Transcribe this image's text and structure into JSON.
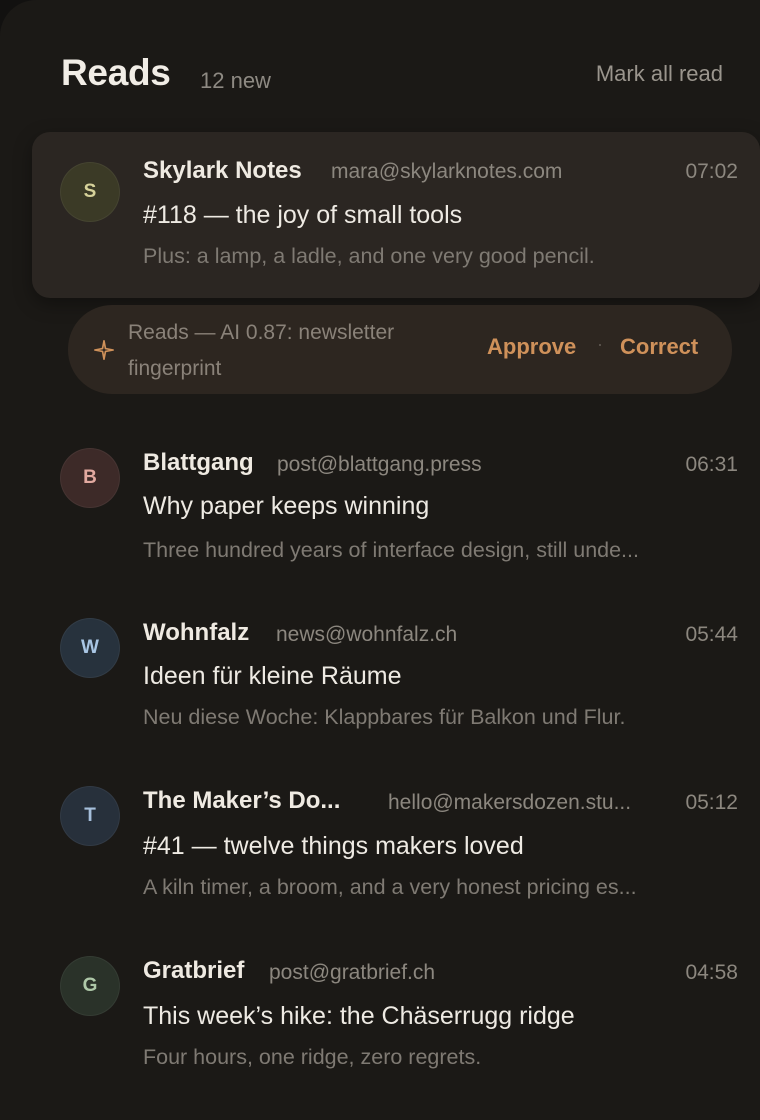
{
  "header": {
    "title": "Reads",
    "new_count": "12 new",
    "mark_all_label": "Mark all read"
  },
  "messages": [
    {
      "initial": "S",
      "sender": "Skylark Notes",
      "email": "mara@skylarknotes.com",
      "time": "07:02",
      "subject": "#118 — the joy of small tools",
      "preview": "Plus: a lamp, a ladle, and one very good pencil.",
      "avatar_bg": "#3b3a26",
      "avatar_fg": "#d6d29a"
    },
    {
      "initial": "B",
      "sender": "Blattgang",
      "email": "post@blattgang.press",
      "time": "06:31",
      "subject": "Why paper keeps winning",
      "preview": "Three hundred years of interface design, still unde...",
      "avatar_bg": "#3d2a28",
      "avatar_fg": "#e2a9a0"
    },
    {
      "initial": "W",
      "sender": "Wohnfalz",
      "email": "news@wohnfalz.ch",
      "time": "05:44",
      "subject": "Ideen für kleine Räume",
      "preview": "Neu diese Woche: Klappbares für Balkon und Flur.",
      "avatar_bg": "#27323d",
      "avatar_fg": "#a9c6e4"
    },
    {
      "initial": "T",
      "sender": "The Maker’s Do...",
      "email": "hello@makersdozen.stu...",
      "time": "05:12",
      "subject": "#41 — twelve things makers loved",
      "preview": "A kiln timer, a broom, and a very honest pricing es...",
      "avatar_bg": "#27303b",
      "avatar_fg": "#a6bfdb"
    },
    {
      "initial": "G",
      "sender": "Gratbrief",
      "email": "post@gratbrief.ch",
      "time": "04:58",
      "subject": "This week’s hike: the Chäserrugg ridge",
      "preview": "Four hours, one ridge, zero regrets.",
      "avatar_bg": "#2a3229",
      "avatar_fg": "#aec8a8"
    }
  ],
  "ai_suggestion": {
    "icon": "sparkle-icon",
    "text": "Reads — AI 0.87: newsletter fingerprint",
    "approve_label": "Approve",
    "separator": "·",
    "correct_label": "Correct",
    "accent_color": "#cf915a"
  }
}
